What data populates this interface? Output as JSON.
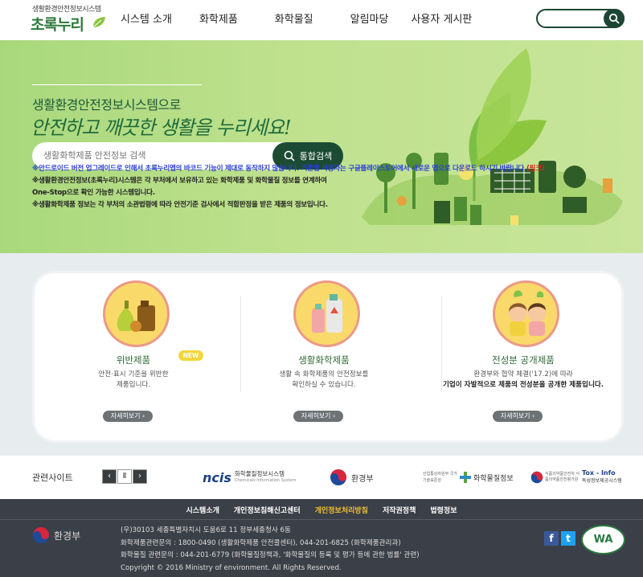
{
  "header": {
    "logo_small": "생활환경안전정보시스템",
    "logo_main": "초록누리",
    "nav": [
      "시스템 소개",
      "화학제품",
      "화학물질",
      "알림마당",
      "사용자 게시판"
    ],
    "search_placeholder": ""
  },
  "hero": {
    "title": "생활환경안전정보시스템으로",
    "slogan": "안전하고 깨끗한 생활을 누리세요!",
    "search_placeholder": "생활화학제품 안전정보 검색",
    "search_button": "통합검색",
    "notice_line1_a": "※안드로이드 버전 업그레이드로 인해서 초록누리앱의 바코드 기능이 제대로 동작하지 않습니다. 기존앱 사용자는 구글플레이스토어에서 새로운 앱으로 다운로드 하시기 바랍니다.",
    "notice_line1_link": "(링크)",
    "notice_line2": "※생활환경안전정보(초록누리)시스템은 각 부처에서 보유하고 있는 화학제품 및 화학물질 정보를 연계하여",
    "notice_line3": "One-Stop으로 확인 가능한 시스템입니다.",
    "notice_line4": "※생활화학제품 정보는 각 부처의 소관법령에 따라 안전기준 검사에서 적합판정을 받은 제품의 정보입니다."
  },
  "cards": [
    {
      "title": "위반제품",
      "badge": "NEW",
      "desc1": "안전·표시 기준을 위반한",
      "desc2": "제품입니다.",
      "button": "자세히보기 ›"
    },
    {
      "title": "생활화학제품",
      "desc1": "생활 속 화학제품의 안전정보를",
      "desc2": "확인하실 수 있습니다.",
      "button": "자세히보기 ›"
    },
    {
      "title": "전성분 공개제품",
      "desc1": "환경부와 협약 체결('17.2)에 따라",
      "desc2": "기업이 자발적으로 제품의 전성분을 공개한 제품입니다.",
      "button": "자세히보기 ›"
    }
  ],
  "related": {
    "label": "관련사이트",
    "pager": [
      "‹",
      "Ⅱ",
      "›"
    ],
    "partners": [
      {
        "mark": "ncis",
        "name": "화학물질정보시스템",
        "sub": "Chemicals Information System"
      },
      {
        "name": "환경부"
      },
      {
        "sub": "산업통상자원부 국가기술표준원",
        "name": "화학물질정보"
      },
      {
        "sub": "식품의약품안전처 식품의약품안전평가원",
        "mark": "Tox - Info",
        "name": "독성정보제공시스템"
      }
    ]
  },
  "footer": {
    "links": [
      "시스템소개",
      "개인정보침해신고센터",
      "개인정보처리방침",
      "저작권정책",
      "법령정보"
    ],
    "logo_text": "환경부",
    "address": "(우)30103 세종특별자치시 도움6로 11 정부세종청사 6동",
    "contact1": "화학제품관련문의 : 1800-0490 (생활화학제품 안전콜센터), 044-201-6825 (화학제품관리과)",
    "contact2": "화학물질 관련문의 : 044-201-6779 (화학물질정책과, '화학물질의 등록 및 평가 등에 관한 법률' 관련)",
    "copyright": "Copyright © 2016 Ministry of environment. All Rights Reserved.",
    "sns": [
      "f",
      "t"
    ],
    "wa_mark": "WA"
  },
  "colors": {
    "brand_green": "#2d7a3a",
    "dark_green": "#1c4b34",
    "hero_green": "#b6dd86",
    "footer_bg": "#3b3f48",
    "highlight": "#f1c232"
  }
}
